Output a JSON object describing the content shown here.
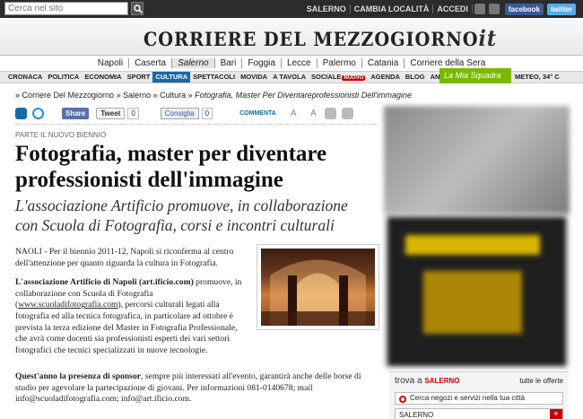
{
  "topbar": {
    "search_placeholder": "Cerca nel sito",
    "links": [
      "SALERNO",
      "CAMBIA LOCALITÀ",
      "ACCEDI"
    ],
    "facebook": "facebook",
    "twitter": "twitter"
  },
  "masthead": {
    "logo": "CORRIERE DEL MEZZOGIORNO",
    "logo_suffix": "it"
  },
  "cities": [
    "Napoli",
    "Caserta",
    "Salerno",
    "Bari",
    "Foggia",
    "Lecce",
    "Palermo",
    "Catania",
    "Corriere della Sera"
  ],
  "active_city": "Salerno",
  "sections": [
    "CRONACA",
    "POLITICA",
    "ECONOMIA",
    "SPORT",
    "CULTURA",
    "SPETTACOLI",
    "MOVIDA",
    "A TAVOLA",
    "SOCIALE",
    "AGENDA",
    "BLOG",
    "ANNUNCI"
  ],
  "sections_new_badge": "NUOVO",
  "mia_squadra": "La Mia Squadra",
  "meteo": "METEO, 34° C",
  "breadcrumb": [
    "Corriere Del Mezzogiorno",
    "Salerno",
    "Cultura"
  ],
  "breadcrumb_last": "Fotografia, Master Per Diventareprofessionisti Dell'immagine",
  "social": {
    "share": "Share",
    "tweet": "Tweet",
    "tweet_count": "0",
    "fb_like": "Consiglia",
    "fb_count": "0",
    "comments": "COMMENTA",
    "tools": "A A"
  },
  "article": {
    "kicker": "PARTE IL NUOVO BIENNIO",
    "headline": "Fotografia, master per diventare professionisti dell'immagine",
    "subhead": "L'associazione Artificio promuove, in collaborazione con Scuola di Fotografia, corsi e incontri culturali",
    "p1": "NAOLI - Per il biennio 2011-12, Napoli si riconferma al centro dell'attenzione per quanto riguarda la cultura in Fotografia.",
    "p2_bold": "L'associazione Artificio di Napoli (art.ificio.com)",
    "p2_a": " promuove, in collaborazione con Scuola di Fotografia (",
    "p2_link": "www.scuoladifotografia.com",
    "p2_b": "), percorsi culturali legati alla fotografia ed alla tecnica fotografica, in particolare ad ottobre è prevista la terza edizione del Master in Fotografia Professionale, che avrà come docenti sia professionisti esperti dei vari settori fotografici che tecnici specializzati in nuove tecnologie.",
    "p3_bold": "Quest'anno la presenza di sponsor",
    "p3_rest": ", sempre più interessati all'evento, garantirà anche delle borse di studio per agevolare la partecipazione di giovani. Per informazioni 081-0140678; mail info@scuoladifotografia.com; info@art.ificio.com."
  },
  "trova": {
    "title": "trova a",
    "city": "SALERNO",
    "all": "tutte le offerte",
    "input_placeholder": "Cerca negozi e servizi nella tua città",
    "select_value": "SALERNO",
    "go": "»"
  }
}
